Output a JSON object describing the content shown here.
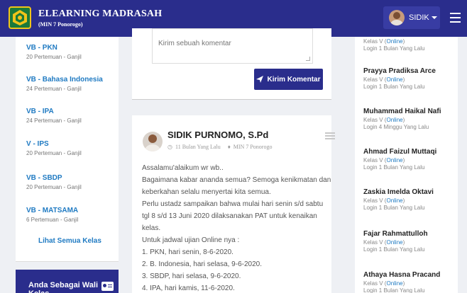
{
  "header": {
    "title": "ELEARNING MADRASAH",
    "subtitle": "(MIN 7 Ponorogo)",
    "user_name": "SIDIK",
    "logo_icon": "madrasah-logo",
    "menu_icon": "hamburger-icon",
    "bg_color": "#2a2d8c"
  },
  "classes": {
    "items": [
      {
        "name": "VB - PKN",
        "meta": "20 Pertemuan - Ganjil"
      },
      {
        "name": "VB - Bahasa Indonesia",
        "meta": "24 Pertemuan - Ganjil"
      },
      {
        "name": "VB - IPA",
        "meta": "24 Pertemuan - Ganjil"
      },
      {
        "name": "V - IPS",
        "meta": "20 Pertemuan - Ganjil"
      },
      {
        "name": "VB - SBDP",
        "meta": "20 Pertemuan - Ganjil"
      },
      {
        "name": "VB - MATSAMA",
        "meta": "6 Pertemuan - Ganjil"
      }
    ],
    "see_all": "Lihat Semua Kelas",
    "link_color": "#1f7ac2"
  },
  "wali": {
    "label": "Anda Sebagai Wali Kelas",
    "icon": "id-card-icon"
  },
  "comment": {
    "placeholder": "Kirim sebuah komentar",
    "button_label": "Kirim Komentar",
    "button_icon": "send-icon"
  },
  "post": {
    "author": "SIDIK PURNOMO, S.Pd",
    "time": "11 Bulan Yang Lalu",
    "location": "MIN 7 Ponorogo",
    "lines": [
      "Assalamu'alaikum wr wb..",
      "Bagaimana kabar ananda semua? Semoga kenikmatan dan",
      "keberkahan selalu menyertai kita semua.",
      "Perlu ustadz sampaikan bahwa mulai hari senin s/d sabtu",
      "tgl 8 s/d 13 Juni 2020 dilaksanakan PAT untuk kenaikan",
      "kelas.",
      "Untuk jadwal ujian Online nya :",
      "1. PKN, hari senin, 8-6-2020.",
      "2. B. Indonesia, hari selasa, 9-6-2020.",
      "3. SBDP, hari selasa, 9-6-2020.",
      "4. IPA, hari kamis, 11-6-2020."
    ]
  },
  "students": {
    "status_prefix": "Kelas V (",
    "status_online": "Online",
    "status_suffix": ")",
    "items": [
      {
        "name": "",
        "login": "Login 1 Bulan Yang Lalu"
      },
      {
        "name": "Prayya Pradiksa Arce",
        "login": "Login 1 Bulan Yang Lalu"
      },
      {
        "name": "Muhammad Haikal Nafi",
        "login": "Login 4 Minggu Yang Lalu"
      },
      {
        "name": "Ahmad Faizul Muttaqi",
        "login": "Login 1 Bulan Yang Lalu"
      },
      {
        "name": "Zaskia Imelda Oktavi",
        "login": "Login 1 Bulan Yang Lalu"
      },
      {
        "name": "Fajar Rahmattulloh",
        "login": "Login 1 Bulan Yang Lalu"
      },
      {
        "name": "Athaya Hasna Pracand",
        "login": "Login 1 Bulan Yang Lalu"
      }
    ]
  }
}
